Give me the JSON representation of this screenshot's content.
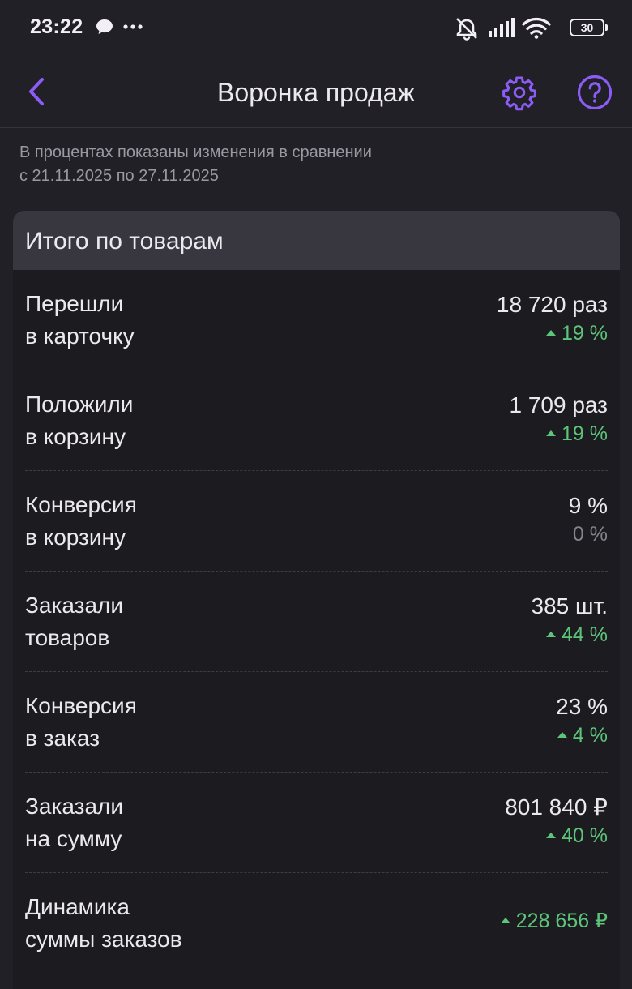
{
  "status_bar": {
    "time": "23:22",
    "battery": "30",
    "left_icons": [
      "chat-bubble-icon",
      "more-dots-icon"
    ],
    "right_icons": [
      "alarm-off-icon",
      "signal-icon",
      "wifi-icon",
      "battery-icon"
    ]
  },
  "header": {
    "title": "Воронка продаж",
    "back_icon": "chevron-left-icon",
    "settings_icon": "gear-icon",
    "help_icon": "question-icon",
    "accent_color": "#8b5cf6"
  },
  "subtitle": {
    "line1": "В процентах показаны изменения в сравнении",
    "line2": "с 21.11.2025 по 27.11.2025"
  },
  "card": {
    "title": "Итого по товарам",
    "rows": [
      {
        "label1": "Перешли",
        "label2": "в карточку",
        "value": "18 720 раз",
        "change": "19 %",
        "trend": "up"
      },
      {
        "label1": "Положили",
        "label2": "в корзину",
        "value": "1 709 раз",
        "change": "19 %",
        "trend": "up"
      },
      {
        "label1": "Конверсия",
        "label2": "в корзину",
        "value": "9 %",
        "change": "0 %",
        "trend": "neutral"
      },
      {
        "label1": "Заказали",
        "label2": "товаров",
        "value": "385 шт.",
        "change": "44 %",
        "trend": "up"
      },
      {
        "label1": "Конверсия",
        "label2": "в заказ",
        "value": "23 %",
        "change": "4 %",
        "trend": "up"
      },
      {
        "label1": "Заказали",
        "label2": "на сумму",
        "value": "801 840 ₽",
        "change": "40 %",
        "trend": "up"
      },
      {
        "label1": "Динамика",
        "label2": "суммы заказов",
        "value": "",
        "change": "228 656 ₽",
        "trend": "up"
      }
    ]
  },
  "colors": {
    "background": "#222027",
    "positive": "#5dc57a",
    "neutral": "#86838d"
  }
}
